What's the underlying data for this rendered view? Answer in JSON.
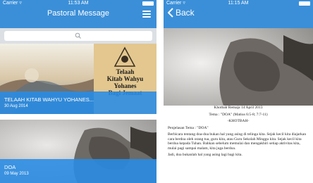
{
  "left": {
    "status": {
      "carrier": "Carrier ▿",
      "time": "11:53 AM"
    },
    "nav": {
      "title": "Pastoral Message",
      "menu_icon": "hamburger-menu-icon"
    },
    "search": {
      "icon": "search-icon",
      "placeholder": ""
    },
    "cards": [
      {
        "image_text": [
          "Telaah",
          "Kitab Wahyu",
          "Yohanes",
          "Bagi Jemaat"
        ],
        "title": "TELAAH KITAB WAHYU YOHANES...",
        "date": "30 Aug 2014"
      },
      {
        "title": "DOA",
        "date": "09 May 2013"
      }
    ],
    "colors": {
      "header": "#3b8fd8",
      "caption": "#288ce6"
    }
  },
  "right": {
    "status": {
      "carrier": "Carrier ▿",
      "time": "11:15 AM"
    },
    "nav": {
      "back_label": "Back",
      "back_icon": "chevron-left-icon"
    },
    "sermon": {
      "heading1": "Khotbah Remaja 14 April 2013",
      "heading2": "Tema : \"DOA\" (Matius 6:5-8; 7:7-11)",
      "section": "-KHOTBAH-",
      "intro": "Penjelasan Tema : \"DOA\"",
      "para1": "Berbicara tentang doa-doa bukan hal yang asing di telinga kita. Sejak kecil kita diajarkan cara berdoa oleh orang tua, guru kita, atau Guru Sekolah Minggu kita. Sejak kecil kita berdoa kepada Tuhan. Bahkan sebelum memulai dan mengakhiri setiap aktivitas kita, mulai pagi sampai malam, kita juga berdoa.",
      "para2": "Jadi, doa bukanlah hal yang asing lagi bagi kita."
    }
  }
}
